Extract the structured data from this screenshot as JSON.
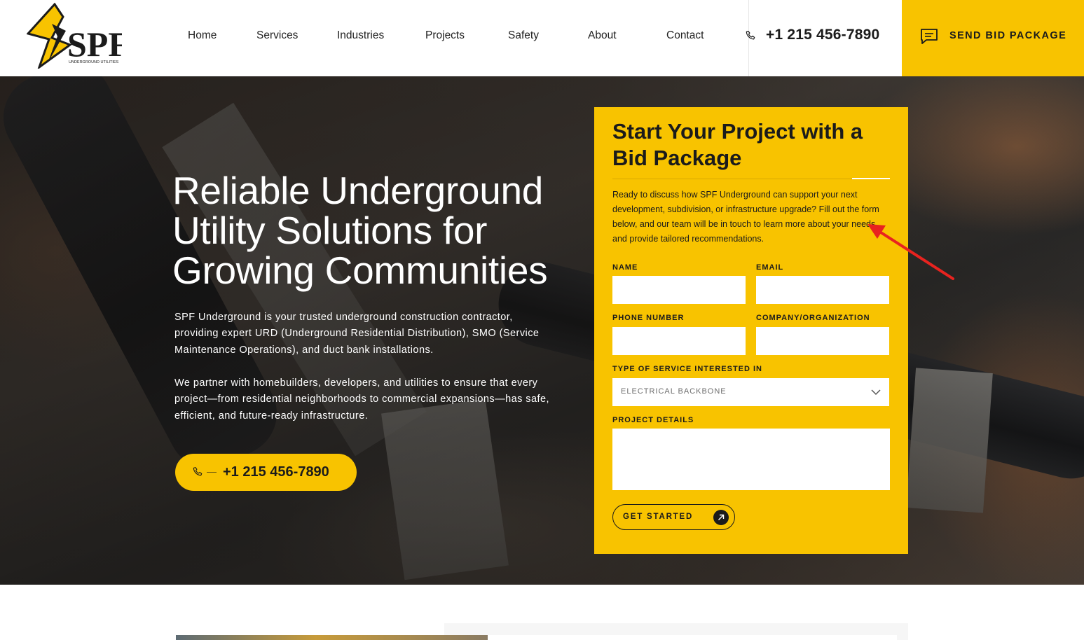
{
  "header": {
    "logo": {
      "text": "SPF",
      "subtitle": "UNDERGROUND UTILITIES"
    },
    "nav": [
      {
        "label": "Home"
      },
      {
        "label": "Services"
      },
      {
        "label": "Industries"
      },
      {
        "label": "Projects"
      },
      {
        "label": "Safety"
      },
      {
        "label": "About"
      },
      {
        "label": "Contact"
      }
    ],
    "phone": {
      "icon": "phone-icon",
      "number": "+1 215 456-7890"
    },
    "cta": {
      "icon": "chat-icon",
      "label": "SEND BID PACKAGE"
    }
  },
  "hero": {
    "title": "Reliable Underground Utility Solutions for Growing Communities",
    "paragraph1": "SPF Underground is your trusted underground construction contractor, providing expert URD (Underground Residential Distribution), SMO (Service Maintenance Operations), and duct bank installations.",
    "paragraph2": "We partner with homebuilders, developers, and utilities to ensure that every project—from residential neighborhoods to commercial expansions—has safe, efficient, and future-ready infrastructure.",
    "call_button": {
      "icon": "phone-icon",
      "number": "+1 215 456-7890"
    }
  },
  "form": {
    "title": "Start Your Project with a Bid Package",
    "description": "Ready to discuss how SPF Underground can support your next development, subdivision, or infrastructure upgrade? Fill out the form below, and our team will be in touch to learn more about your needs and provide tailored recommendations.",
    "fields": {
      "name_label": "NAME",
      "name_value": "",
      "email_label": "EMAIL",
      "email_value": "",
      "phone_label": "PHONE NUMBER",
      "phone_value": "",
      "company_label": "COMPANY/ORGANIZATION",
      "company_value": "",
      "service_label": "TYPE OF SERVICE INTERESTED IN",
      "service_value": "ELECTRICAL BACKBONE",
      "details_label": "PROJECT DETAILS",
      "details_value": ""
    },
    "submit": {
      "label": "GET STARTED",
      "icon": "arrow-up-right-icon"
    }
  },
  "colors": {
    "brand_yellow": "#f8c300",
    "text_dark": "#1b1b1b",
    "annotation_red": "#e8231f"
  }
}
